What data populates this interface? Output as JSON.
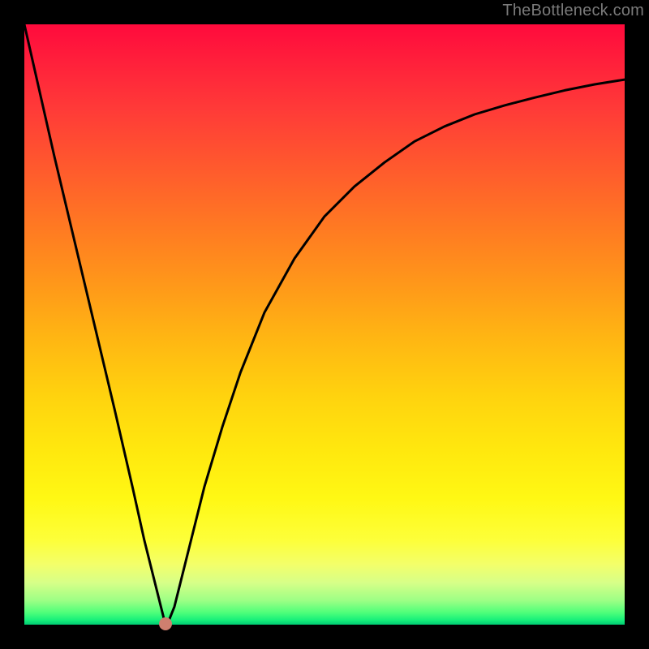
{
  "credit": "TheBottleneck.com",
  "marker": {
    "x_pct": 23.5,
    "y_pct": 99.8
  },
  "chart_data": {
    "type": "line",
    "title": "",
    "xlabel": "",
    "ylabel": "",
    "xlim": [
      0,
      100
    ],
    "ylim": [
      0,
      100
    ],
    "grid": false,
    "legend": false,
    "series": [
      {
        "name": "curve",
        "x": [
          0,
          5,
          10,
          15,
          18,
          20,
          21,
          22,
          23,
          23.5,
          24,
          25,
          26,
          28,
          30,
          33,
          36,
          40,
          45,
          50,
          55,
          60,
          65,
          70,
          75,
          80,
          85,
          90,
          95,
          100
        ],
        "y": [
          100,
          78,
          57,
          36,
          23,
          14,
          10,
          6,
          2,
          0,
          0.5,
          3,
          7,
          15,
          23,
          33,
          42,
          52,
          61,
          68,
          73,
          77,
          80.5,
          83,
          85,
          86.5,
          87.8,
          89,
          90,
          90.8
        ]
      }
    ],
    "marker_point": {
      "x": 23.5,
      "y": 0
    }
  }
}
